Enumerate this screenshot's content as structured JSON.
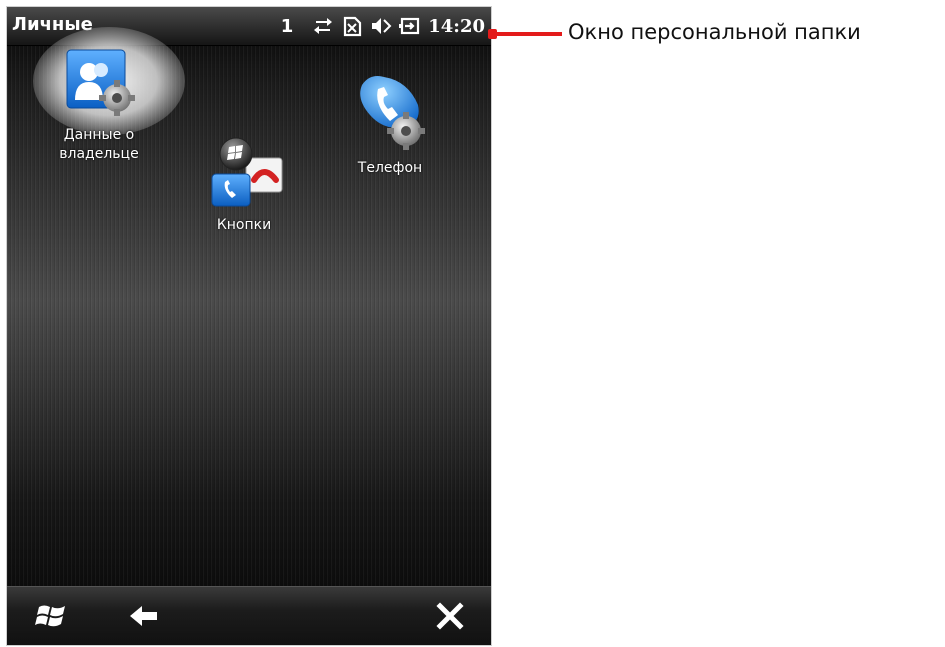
{
  "statusbar": {
    "title": "Личные",
    "counter": "1",
    "time": "14:20",
    "icons": [
      "data-connection-icon",
      "no-sim-icon",
      "volume-muted-icon",
      "battery-icon"
    ]
  },
  "apps": [
    {
      "label_line1": "Данные о",
      "label_line2": "владельце",
      "icon": "owner-info-icon"
    },
    {
      "label": "Кнопки",
      "icon": "buttons-icon"
    },
    {
      "label": "Телефон",
      "icon": "phone-settings-icon"
    }
  ],
  "softbar": {
    "icons": [
      "windows-start-icon",
      "back-arrow-icon",
      "close-icon"
    ]
  },
  "annotation": {
    "text": "Окно персональной папки",
    "color": "#e31b1b"
  }
}
